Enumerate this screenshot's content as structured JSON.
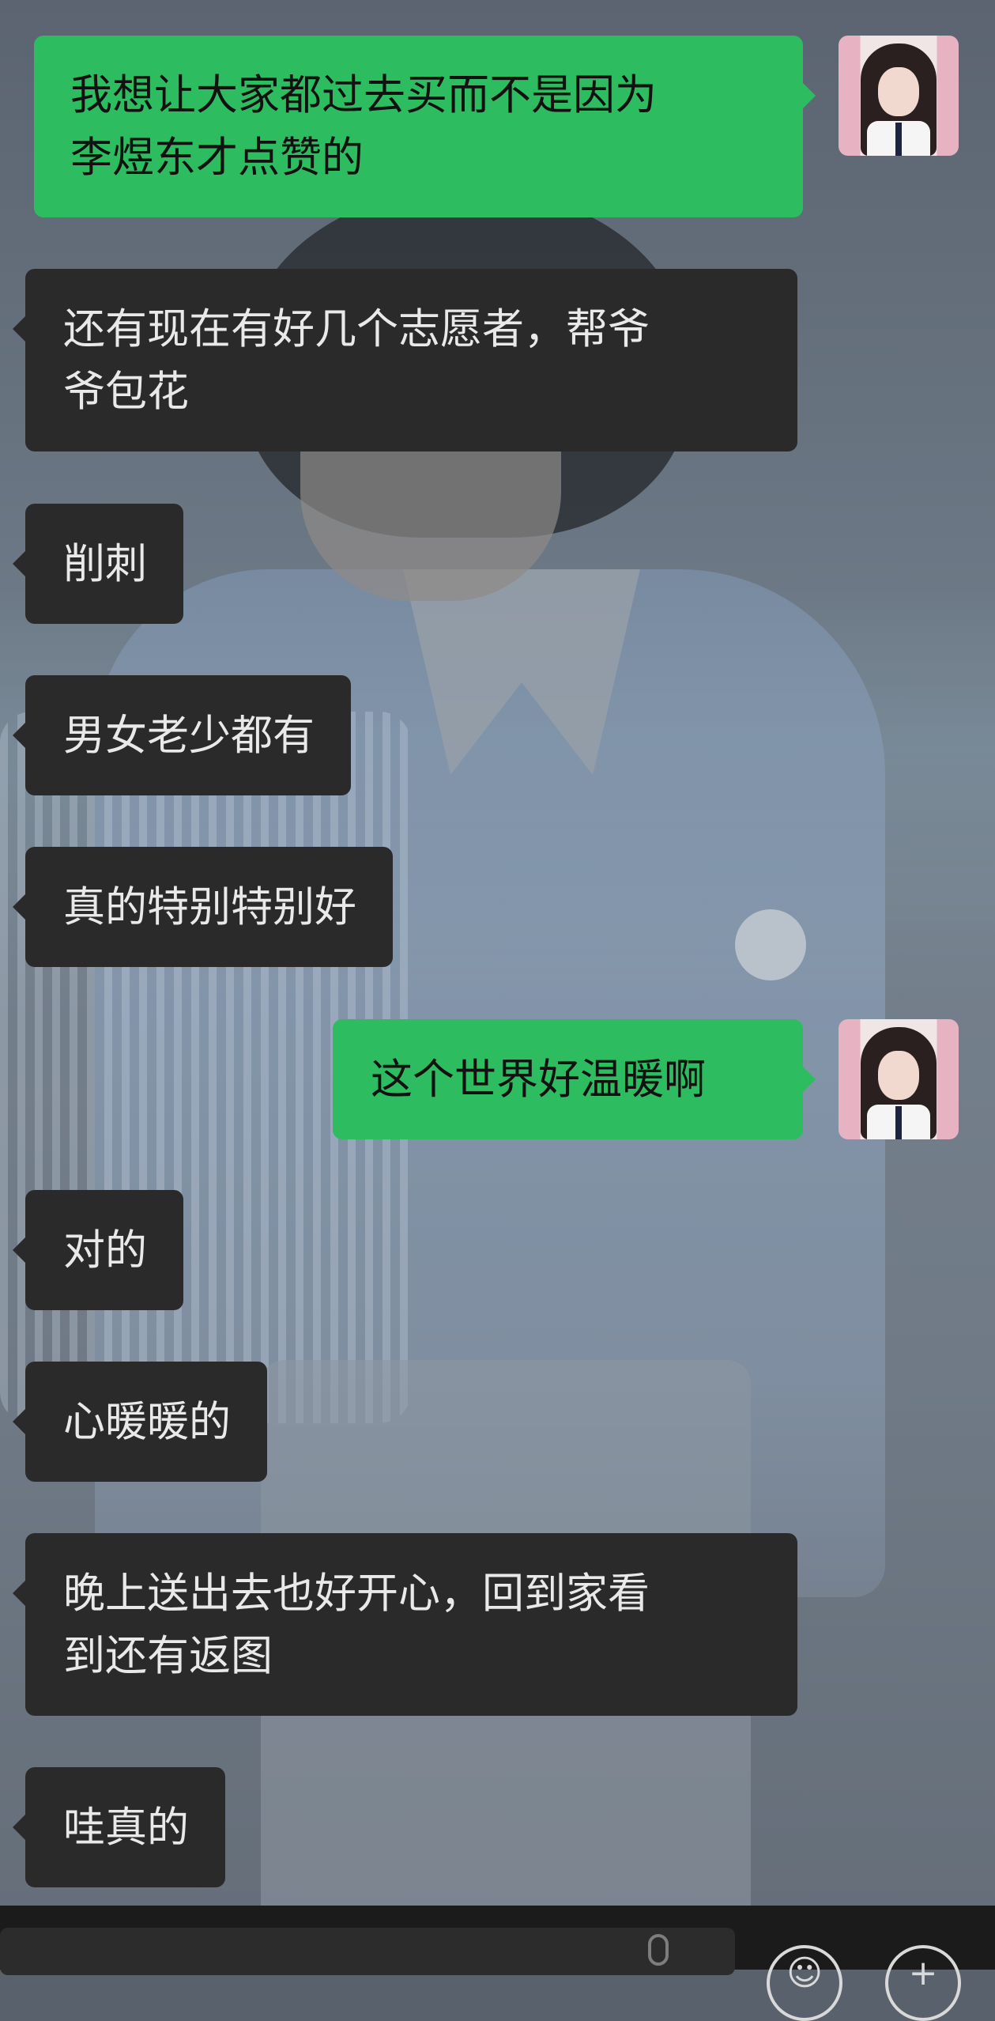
{
  "messages": [
    {
      "side": "outgoing",
      "lines": [
        "我想让大家都过去买而不是因为",
        "李煜东才点赞的"
      ]
    },
    {
      "side": "incoming",
      "lines": [
        "还有现在有好几个志愿者，帮爷",
        "爷包花"
      ]
    },
    {
      "side": "incoming",
      "lines": [
        "削刺"
      ]
    },
    {
      "side": "incoming",
      "lines": [
        "男女老少都有"
      ]
    },
    {
      "side": "incoming",
      "lines": [
        "真的特别特别好"
      ]
    },
    {
      "side": "outgoing",
      "lines": [
        "这个世界好温暖啊"
      ]
    },
    {
      "side": "incoming",
      "lines": [
        "对的"
      ]
    },
    {
      "side": "incoming",
      "lines": [
        "心暖暖的"
      ]
    },
    {
      "side": "incoming",
      "lines": [
        "晚上送出去也好开心，回到家看",
        "到还有返图"
      ]
    },
    {
      "side": "incoming",
      "lines": [
        "哇真的"
      ]
    }
  ],
  "colors": {
    "incoming_bubble": "#2a2a2a",
    "outgoing_bubble": "#2ebc61",
    "incoming_text": "#e9e9e9",
    "outgoing_text": "#111111"
  },
  "icons": {
    "voice": "mic-icon",
    "emoji": "emoji-icon",
    "more": "plus-icon"
  }
}
